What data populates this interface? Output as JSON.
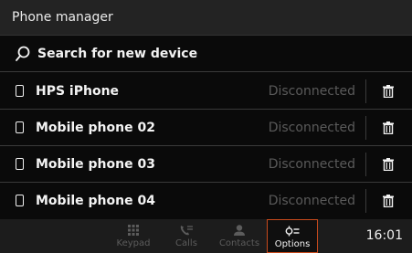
{
  "header": {
    "title": "Phone manager"
  },
  "search": {
    "label": "Search for new device",
    "icon": "search-icon"
  },
  "devices": [
    {
      "name": "HPS iPhone",
      "status": "Disconnected"
    },
    {
      "name": "Mobile phone 02",
      "status": "Disconnected"
    },
    {
      "name": "Mobile phone 03",
      "status": "Disconnected"
    },
    {
      "name": "Mobile phone 04",
      "status": "Disconnected"
    }
  ],
  "nav": {
    "items": [
      {
        "label": "Keypad",
        "icon": "keypad-icon"
      },
      {
        "label": "Calls",
        "icon": "calls-icon"
      },
      {
        "label": "Contacts",
        "icon": "contacts-icon"
      },
      {
        "label": "Options",
        "icon": "options-icon",
        "active": true
      }
    ]
  },
  "status": {
    "time": "16:01"
  },
  "colors": {
    "accent": "#c84a1c",
    "background": "#0a0a0a",
    "inactive_text": "#5a5a5a"
  }
}
